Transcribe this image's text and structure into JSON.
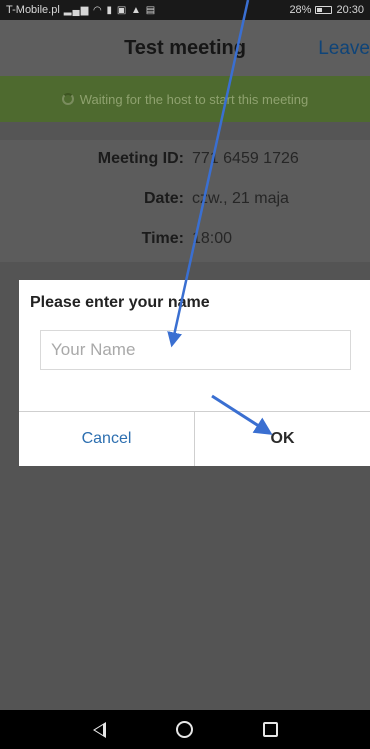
{
  "status_bar": {
    "carrier": "T-Mobile.pl",
    "icons": "signal wifi video media upload calendar",
    "battery": "28%",
    "time": "20:30"
  },
  "header": {
    "title": "Test meeting",
    "leave_label": "Leave"
  },
  "banner": {
    "text": "Waiting for the host to start this meeting",
    "color": "#4e6a2f"
  },
  "meeting_info": {
    "id_label": "Meeting ID:",
    "id_value": "771 6459 1726",
    "date_label": "Date:",
    "date_value": "czw., 21 maja",
    "time_label": "Time:",
    "time_value": "18:00"
  },
  "dialog": {
    "title": "Please enter your name",
    "input_value": "",
    "input_placeholder": "Your Name",
    "cancel_label": "Cancel",
    "ok_label": "OK"
  },
  "colors": {
    "accent": "#2d6fb0",
    "annotation_arrow": "#3a6fd1"
  }
}
